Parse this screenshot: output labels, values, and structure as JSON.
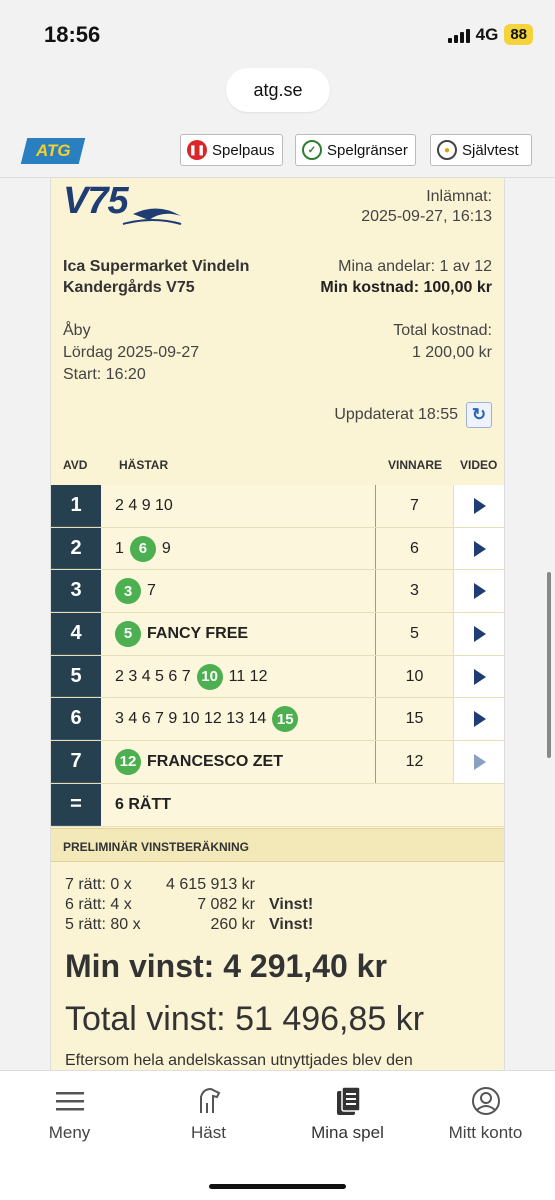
{
  "status": {
    "time": "18:56",
    "network": "4G",
    "battery": "88"
  },
  "browser": {
    "url": "atg.se"
  },
  "nav": {
    "logo": "ATG",
    "spelpaus": "Spelpaus",
    "spelgranser": "Spelgränser",
    "sjalvtest": "Självtest"
  },
  "coupon": {
    "game": "V75",
    "submitted_label": "Inlämnat:",
    "submitted_value": "2025-09-27, 16:13",
    "shop": "Ica Supermarket Vindeln",
    "team": "Kandergårds V75",
    "shares": "Mina andelar: 1 av 12",
    "min_cost": "Min kostnad: 100,00 kr",
    "track": "Åby",
    "date": "Lördag 2025-09-27",
    "start": "Start: 16:20",
    "total_cost_label": "Total kostnad:",
    "total_cost_value": "1 200,00 kr",
    "updated": "Uppdaterat 18:55"
  },
  "table": {
    "headers": {
      "avd": "AVD",
      "hastar": "HÄSTAR",
      "vinnare": "VINNARE",
      "video": "VIDEO"
    },
    "rows": [
      {
        "avd": "1",
        "before": "2 4 9 10",
        "winner_badge": "",
        "after": "",
        "vinnare": "7"
      },
      {
        "avd": "2",
        "before": "1",
        "winner_badge": "6",
        "after": "9",
        "vinnare": "6"
      },
      {
        "avd": "3",
        "before": "",
        "winner_badge": "3",
        "after": "7",
        "vinnare": "3"
      },
      {
        "avd": "4",
        "before": "",
        "winner_badge": "5",
        "after": "FANCY FREE",
        "vinnare": "5"
      },
      {
        "avd": "5",
        "before": "2 3 4 5 6 7",
        "winner_badge": "10",
        "after": "11 12",
        "vinnare": "10"
      },
      {
        "avd": "6",
        "before": "3 4 6 7 9 10 12 13 14",
        "winner_badge": "15",
        "after": "",
        "vinnare": "15"
      },
      {
        "avd": "7",
        "before": "",
        "winner_badge": "12",
        "after": "FRANCESCO ZET",
        "vinnare": "12"
      }
    ],
    "sum": {
      "symbol": "=",
      "text": "6 RÄTT"
    }
  },
  "prelim": {
    "heading": "PRELIMINÄR VINSTBERÄKNING",
    "rows": [
      {
        "label": "7 rätt: 0 x",
        "amount": "4 615 913 kr",
        "note": ""
      },
      {
        "label": "6 rätt: 4 x",
        "amount": "7 082 kr",
        "note": "Vinst!"
      },
      {
        "label": "5 rätt: 80 x",
        "amount": "260 kr",
        "note": "Vinst!"
      }
    ],
    "min_vinst": "Min vinst: 4 291,40 kr",
    "total_vinst": "Total vinst: 51 496,85 kr",
    "footnote": "Eftersom hela andelskassan utnyttjades blev den"
  },
  "tabbar": {
    "meny": "Meny",
    "hast": "Häst",
    "mina_spel": "Mina spel",
    "mitt_konto": "Mitt konto"
  },
  "colors": {
    "accent": "#1f3c73",
    "win": "#4caf50",
    "card": "#faf3d4",
    "avd": "#26404f"
  }
}
